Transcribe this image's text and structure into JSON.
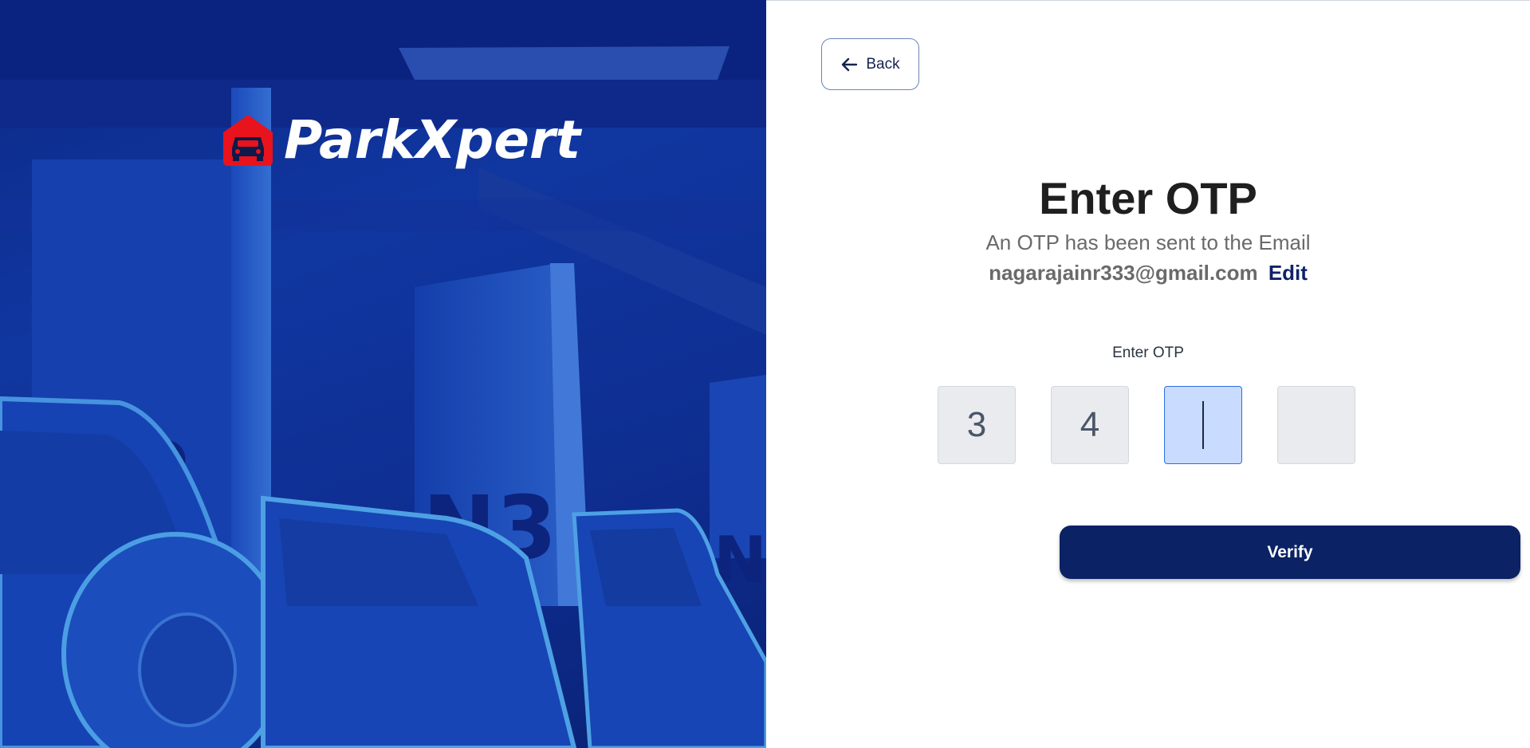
{
  "brand": {
    "name": "ParkXpert",
    "accent": "#e8131c"
  },
  "hero": {
    "background_color": "#123aa8",
    "signs": [
      "2",
      "N3",
      "N"
    ]
  },
  "nav": {
    "back_label": "Back"
  },
  "main": {
    "title": "Enter OTP",
    "subtitle": "An OTP has been sent to the Email",
    "email": "nagarajainr333@gmail.com",
    "edit_label": "Edit"
  },
  "otp": {
    "label": "Enter OTP",
    "digits": [
      "3",
      "4",
      "",
      ""
    ],
    "active_index": 2
  },
  "actions": {
    "verify_label": "Verify",
    "verify_color": "#0b2265"
  }
}
